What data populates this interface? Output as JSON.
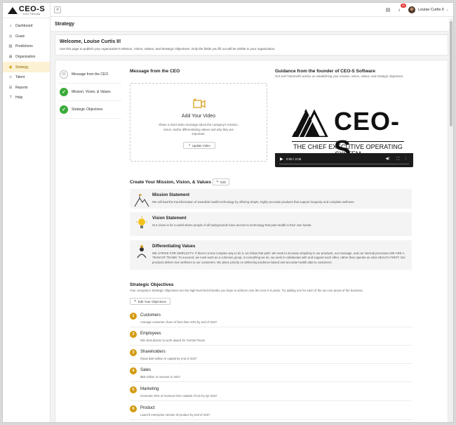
{
  "brand": {
    "name": "CEO-S",
    "sub": "SOFTWARE"
  },
  "sidebar": {
    "items": [
      {
        "label": "Dashboard",
        "icon": "home-icon"
      },
      {
        "label": "Goals",
        "icon": "target-icon"
      },
      {
        "label": "Predictions",
        "icon": "chart-icon"
      },
      {
        "label": "Organization",
        "icon": "org-icon"
      },
      {
        "label": "Strategy",
        "icon": "strategy-icon",
        "active": true
      },
      {
        "label": "Talent",
        "icon": "people-icon"
      },
      {
        "label": "Reports",
        "icon": "report-icon"
      },
      {
        "label": "Help",
        "icon": "help-icon"
      }
    ]
  },
  "topbar": {
    "notification_count": "99",
    "user_name": "Louise Curtis II"
  },
  "page": {
    "title": "Strategy"
  },
  "welcome": {
    "title": "Welcome, Louise Curtis II!",
    "text": "Use this page to publish your organization's Mission, Vision, Values, and Strategic Objectives. Only the fields you fill out will be visible to your organization."
  },
  "steps": [
    {
      "label": "Message from the CEO",
      "state": "pending",
      "num": "01"
    },
    {
      "label": "Mission, Vision, & Values",
      "state": "done"
    },
    {
      "label": "Strategic Objectives",
      "state": "done"
    }
  ],
  "ceo_message": {
    "title": "Message from the CEO",
    "box_title": "Add Your Video",
    "box_desc": "Share a short video message about the company's mission, vision, and/or differentiating values and why they are important.",
    "button": "Update Video"
  },
  "guidance": {
    "title": "Guidance from the founder of CEO-S Software",
    "desc": "Get Joel Trammell's advice on establishing your mission, vision, values, and strategic objectives.",
    "video_brand": "CEO-S",
    "video_tagline": "THE CHIEF EXECUTIVE OPERATING SYSTEM",
    "time": "0:00 / 2:06"
  },
  "mvv": {
    "title": "Create Your Mission, Vision, & Values",
    "edit": "Edit",
    "cards": [
      {
        "title": "Mission Statement",
        "text": "We will lead the transformation of wearable health technology by offering simple, highly accurate products that support longevity and complete wellness."
      },
      {
        "title": "Vision Statement",
        "text": "Our vision is for a world where people of all backgrounds have access to technology that puts health in their own hands."
      },
      {
        "title": "Differentiating Values",
        "text": "WE STRIVE FOR SIMPLICITY: If there's a less complex way to do it, we follow that path. We seek to increase simplicity in our products, our message, and our internal processes.WE ARE A TEAM OF TEAMS: To succeed, we must work as a cohesive group, in everything we do. we seek to collaborate with and support each other, rather than operate as silos.HEALTH FIRST: Our products deliver true wellness to our customers. We place priority on delivering evidence-based and accurate health data to customers."
      }
    ]
  },
  "objectives": {
    "title": "Strategic Objectives",
    "desc": "Your company's Strategic Objectives are the high-level benchmarks you hope to achieve over the next 2–5 years. Try adding one for each of the six core areas of the business.",
    "button": "Edit Your Objectives",
    "items": [
      {
        "num": "1",
        "title": "Customers",
        "desc": "Average customer churn of less than 10% by end of 2027"
      },
      {
        "num": "2",
        "title": "Employees",
        "desc": "Win best places to work award for Central Texas"
      },
      {
        "num": "3",
        "title": "Shareholders",
        "desc": "Raise $20 million in capital by end of 2027"
      },
      {
        "num": "4",
        "title": "Sales",
        "desc": "$50 million in revenue in 2027"
      },
      {
        "num": "5",
        "title": "Marketing",
        "desc": "Generate 20% of revenue from outside of US by Q2 2027"
      },
      {
        "num": "6",
        "title": "Product",
        "desc": "Launch enterprise version of product by end of 2027"
      }
    ]
  },
  "colors": {
    "accent": "#d49b10",
    "success": "#3aab3a",
    "badge": "#e53935"
  }
}
